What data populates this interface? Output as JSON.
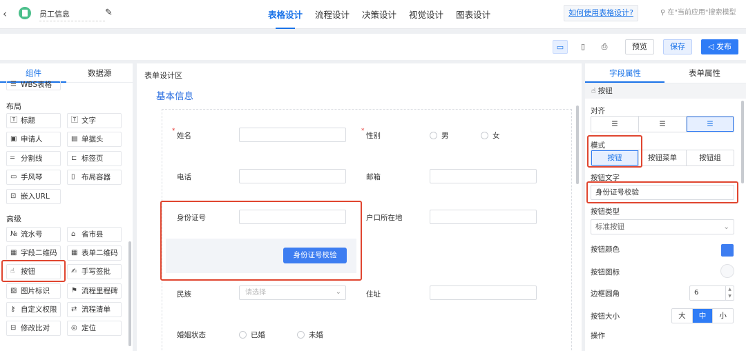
{
  "header": {
    "back_icon": "chevron-left-icon",
    "app_icon": "document-icon",
    "app_name": "员工信息",
    "edit_icon": "pencil-icon",
    "tabs": [
      {
        "label": "表格设计",
        "active": true
      },
      {
        "label": "流程设计"
      },
      {
        "label": "决策设计"
      },
      {
        "label": "视觉设计"
      },
      {
        "label": "图表设计"
      }
    ],
    "help_link": "如何使用表格设计?",
    "search_placeholder": "在\"当前应用\"搜索模型",
    "accent_color": "#1a73e8"
  },
  "toolbar": {
    "device_icons": [
      "desktop-icon",
      "mobile-icon",
      "print-icon"
    ],
    "preview": "预览",
    "save": "保存",
    "publish": "发布"
  },
  "left_panel": {
    "tabs": [
      "组件",
      "数据源"
    ],
    "top_item": "WBS表格",
    "layout_title": "布局",
    "layout_items": [
      "标题",
      "文字",
      "申请人",
      "单据头",
      "分割线",
      "标签页",
      "手风琴",
      "布局容器",
      "嵌入URL"
    ],
    "advanced_title": "高级",
    "advanced_items": [
      "流水号",
      "省市县",
      "字段二维码",
      "表单二维码",
      "按钮",
      "手写签批",
      "图片标识",
      "流程里程碑",
      "自定义权限",
      "流程清单",
      "修改比对",
      "定位"
    ]
  },
  "canvas": {
    "title": "表单设计区",
    "section": "基本信息",
    "fields": {
      "name": "姓名",
      "gender": "性别",
      "gender_options": [
        "男",
        "女"
      ],
      "phone": "电话",
      "email": "邮箱",
      "id_number": "身份证号",
      "hukou": "户口所在地",
      "verify_button": "身份证号校验",
      "ethnicity": "民族",
      "ethnicity_placeholder": "请选择",
      "address": "住址",
      "marital": "婚姻状态",
      "marital_options": [
        "已婚",
        "未婚"
      ]
    }
  },
  "right_panel": {
    "tabs": [
      "字段属性",
      "表单属性"
    ],
    "current": "按钮",
    "align_label": "对齐",
    "align_options": [
      "align-left-icon",
      "align-center-icon",
      "align-right-icon"
    ],
    "mode_label": "模式",
    "mode_options": [
      "按钮",
      "按钮菜单",
      "按钮组"
    ],
    "text_label": "按钮文字",
    "text_value": "身份证号校验",
    "type_label": "按钮类型",
    "type_value": "标准按钮",
    "color_label": "按钮颜色",
    "button_color": "#3d7df1",
    "icon_label": "按钮图标",
    "radius_label": "边框圆角",
    "radius_value": "6",
    "size_label": "按钮大小",
    "size_options": [
      "大",
      "中",
      "小"
    ],
    "action_label": "操作"
  }
}
